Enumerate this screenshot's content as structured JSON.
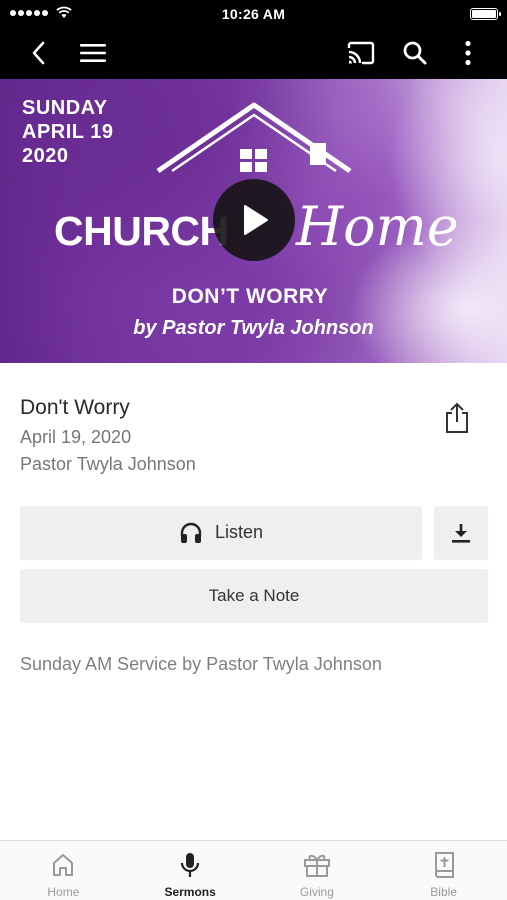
{
  "status_bar": {
    "time": "10:26 AM",
    "battery_level": 1.0
  },
  "nav": {
    "icons": [
      "back-icon",
      "menu-icon",
      "cast-icon",
      "search-icon",
      "more-vertical-icon"
    ]
  },
  "hero": {
    "date_lines": [
      "SUNDAY",
      "APRIL 19",
      "2020"
    ],
    "series_word_1": "CHURCH",
    "series_word_2": "Home",
    "title": "DON’T WORRY",
    "byline": "by  Pastor Twyla Johnson",
    "play_icon": "play-icon"
  },
  "sermon": {
    "title": "Don't Worry",
    "date": "April 19, 2020",
    "speaker": "Pastor Twyla Johnson",
    "description": "Sunday AM Service by Pastor Twyla Johnson",
    "share_icon": "share-icon"
  },
  "actions": {
    "listen_label": "Listen",
    "listen_icon": "headphones-icon",
    "download_icon": "download-icon",
    "note_label": "Take a Note"
  },
  "tabs": [
    {
      "label": "Home",
      "icon": "home-icon",
      "active": false
    },
    {
      "label": "Sermons",
      "icon": "microphone-icon",
      "active": true
    },
    {
      "label": "Giving",
      "icon": "gift-icon",
      "active": false
    },
    {
      "label": "Bible",
      "icon": "bible-icon",
      "active": false
    }
  ],
  "colors": {
    "bar_background": "#000000",
    "button_background": "#eeeff0",
    "hero_purple": "#7a3aa5",
    "active_tab": "#222222",
    "inactive_tab": "#999999"
  }
}
